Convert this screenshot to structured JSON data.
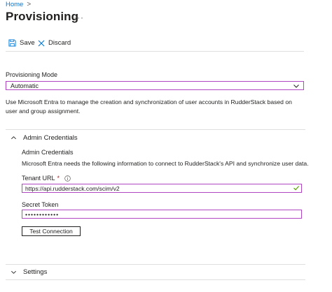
{
  "breadcrumb": {
    "home": "Home",
    "separator": ">"
  },
  "page": {
    "title": "Provisioning",
    "more": "···"
  },
  "toolbar": {
    "save_label": "Save",
    "discard_label": "Discard"
  },
  "provisioning_mode": {
    "label": "Provisioning Mode",
    "value": "Automatic",
    "description": "Use Microsoft Entra to manage the creation and synchronization of user accounts in RudderStack based on user and group assignment."
  },
  "admin_credentials": {
    "header": "Admin Credentials",
    "expanded": true,
    "title": "Admin Credentials",
    "description": "Microsoft Entra needs the following information to connect to RudderStack's API and synchronize user data.",
    "tenant_url": {
      "label": "Tenant URL",
      "required_mark": "*",
      "value": "https://api.rudderstack.com/scim/v2"
    },
    "secret_token": {
      "label": "Secret Token",
      "value": "••••••••••••"
    },
    "test_button": "Test Connection"
  },
  "settings": {
    "header": "Settings",
    "expanded": false
  },
  "icons": {
    "save": "save-icon",
    "discard": "close-icon",
    "chevron": "chevron-down-icon",
    "info": "info-icon",
    "valid": "checkmark-icon"
  },
  "colors": {
    "accent": "#0078d4",
    "focus_border": "#b146c2",
    "required": "#a4262c",
    "valid": "#57a300"
  }
}
